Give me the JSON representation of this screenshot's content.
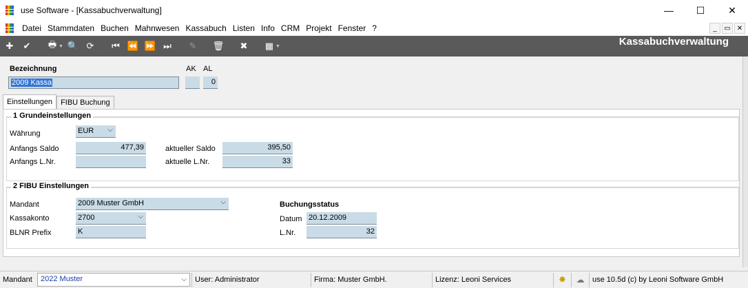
{
  "window": {
    "title": "use Software - [Kassabuchverwaltung]",
    "minimize": "—",
    "maximize": "☐",
    "close": "✕"
  },
  "menu": {
    "items": [
      "Datei",
      "Stammdaten",
      "Buchen",
      "Mahnwesen",
      "Kassabuch",
      "Listen",
      "Info",
      "CRM",
      "Projekt",
      "Fenster",
      "?"
    ],
    "mdi": [
      "_",
      "▭",
      "✕"
    ]
  },
  "toolbar": {
    "title": "Kassabuchverwaltung",
    "icons": {
      "add": "✚",
      "confirm": "✔",
      "print": "🖶",
      "search": "🔍",
      "refresh": "⟳",
      "first": "⏮",
      "prev": "⏪",
      "next": "⏩",
      "last": "⏭",
      "edit": "✎",
      "delete": "🗑",
      "cancel": "✖",
      "grid": "▦"
    }
  },
  "header": {
    "bezeichnung_label": "Bezeichnung",
    "ak_label": "AK",
    "al_label": "AL",
    "bezeichnung_value": "2009 Kassa",
    "ak_value": "",
    "al_value": "0"
  },
  "tabs": [
    {
      "label": "Einstellungen",
      "active": true
    },
    {
      "label": "FIBU Buchung",
      "active": false
    }
  ],
  "grundeinstellungen": {
    "title": "1 Grundeinstellungen",
    "waehrung_label": "Währung",
    "waehrung_value": "EUR",
    "anfangs_saldo_label": "Anfangs Saldo",
    "anfangs_saldo_value": "477,39",
    "anfangs_lnr_label": "Anfangs L.Nr.",
    "anfangs_lnr_value": "",
    "aktueller_saldo_label": "aktueller Saldo",
    "aktueller_saldo_value": "395,50",
    "aktuelle_lnr_label": "aktuelle L.Nr.",
    "aktuelle_lnr_value": "33"
  },
  "fibu": {
    "title": "2 FIBU Einstellungen",
    "mandant_label": "Mandant",
    "mandant_value": "2009 Muster GmbH",
    "kassakonto_label": "Kassakonto",
    "kassakonto_value": "2700",
    "blnr_label": "BLNR Prefix",
    "blnr_value": "K",
    "buchungsstatus_label": "Buchungsstatus",
    "datum_label": "Datum",
    "datum_value": "20.12.2009",
    "lnr_label": "L.Nr.",
    "lnr_value": "32"
  },
  "status": {
    "mandant_label": "Mandant",
    "mandant_value": "2022 Muster",
    "user": "User: Administrator",
    "firma": "Firma: Muster GmbH.",
    "lizenz": "Lizenz: Leoni Services",
    "version": "use 10.5d (c) by Leoni Software GmbH"
  },
  "colors": {
    "toolbar_bg": "#5a5a5a",
    "field_bg": "#c9dbe6",
    "selection": "#3375d6",
    "status_mandant_text": "#1a3ea8"
  }
}
